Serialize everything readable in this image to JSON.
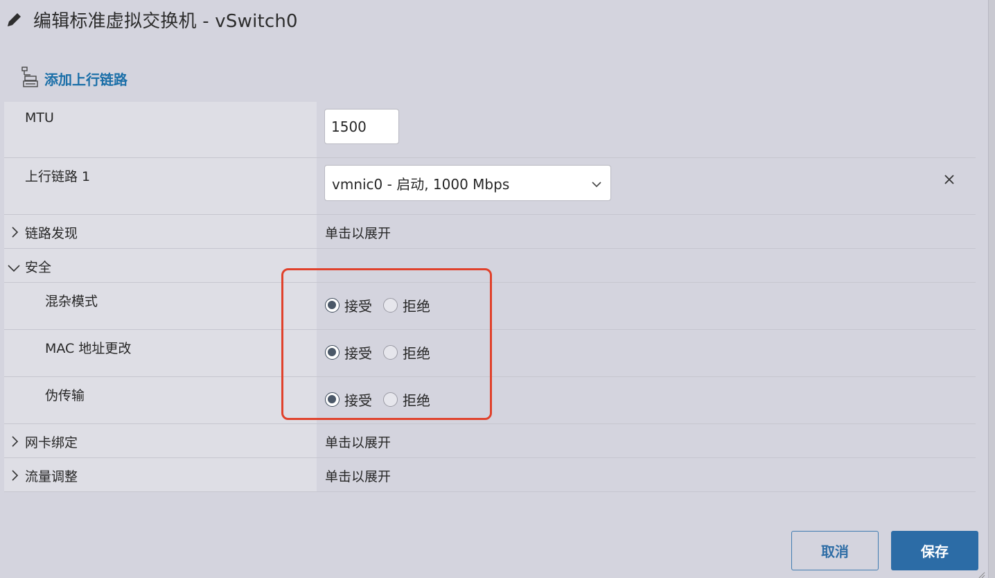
{
  "dialog": {
    "title": "编辑标准虚拟交换机 - vSwitch0",
    "add_uplink_label": "添加上行链路"
  },
  "rows": {
    "mtu": {
      "label": "MTU",
      "value": "1500"
    },
    "uplink1": {
      "label": "上行链路 1",
      "selected": "vmnic0 - 启动, 1000 Mbps"
    },
    "link_discovery": {
      "label": "链路发现",
      "value": "单击以展开"
    },
    "security": {
      "label": "安全"
    },
    "promiscuous": {
      "label": "混杂模式",
      "selected": "接受"
    },
    "mac_change": {
      "label": "MAC 地址更改",
      "selected": "接受"
    },
    "forged": {
      "label": "伪传输",
      "selected": "接受"
    },
    "nic_teaming": {
      "label": "网卡绑定",
      "value": "单击以展开"
    },
    "traffic_shaping": {
      "label": "流量调整",
      "value": "单击以展开"
    }
  },
  "radio_options": {
    "accept": "接受",
    "reject": "拒绝"
  },
  "buttons": {
    "cancel": "取消",
    "save": "保存"
  },
  "colors": {
    "accent": "#2c6ca6",
    "link": "#1b6fa8",
    "highlight": "#e0412b",
    "background": "#d4d4de"
  },
  "icons": [
    "pencil-icon",
    "uplink-icon",
    "chevron-down-icon",
    "close-icon",
    "chevron-right-icon",
    "resize-grip-icon"
  ]
}
